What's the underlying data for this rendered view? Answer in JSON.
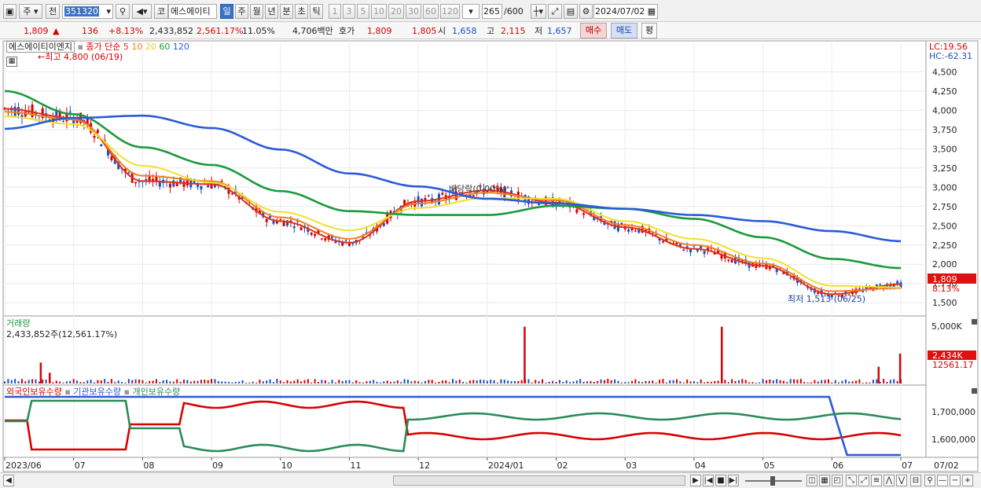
{
  "toolbar": {
    "market_label": "주",
    "view_label": "전",
    "code_value": "351320",
    "name_prefix": "코",
    "stock_name": "에스에이티",
    "period_tabs": [
      "일",
      "주",
      "월",
      "년",
      "분",
      "초",
      "틱"
    ],
    "selected_period": "일",
    "minute_buttons": [
      "1",
      "3",
      "5",
      "10",
      "20",
      "30",
      "60",
      "120"
    ],
    "count_value": "265",
    "count_total": "/600",
    "date_value": "2024/07/02"
  },
  "quote": {
    "price": "1,809",
    "change": "136",
    "change_pct": "+8.13%",
    "volume": "2,433,852",
    "volume_ratio": "2,561.17%",
    "turnover_pct": "11.05%",
    "amount": "4,706백만",
    "quote_label": "호가",
    "ask": "1,809",
    "bid": "1,805",
    "open_label": "시",
    "open": "1,658",
    "high_label": "고",
    "high": "2,115",
    "low_label": "저",
    "low": "1,657",
    "buy_label": "매수",
    "sell_label": "매도",
    "eval_label": "평",
    "up_color": "#d90000",
    "down_color": "#1a4fc4"
  },
  "price_panel": {
    "title": "에스에이티이엔지",
    "ma_label": "종가 단순",
    "ma_periods": [
      "5",
      "10",
      "20",
      "60",
      "120"
    ],
    "ma_colors": [
      "#e03020",
      "#f08020",
      "#f0e030",
      "#1a9a3a",
      "#2a5ad8"
    ],
    "lc_text": "LC:19.56",
    "hc_text": "HC:-62.31",
    "max_annot": "최고 4,800 (06/19)",
    "min_annot": "최저 1,513 (06/25)",
    "dividend_annot": "배당락(0.00%)",
    "current_price_tag": "1,809",
    "current_pct_tag": "8.13%",
    "y_ticks": [
      "4,500",
      "4,250",
      "4,000",
      "3,750",
      "3,500",
      "3,250",
      "3,000",
      "2,750",
      "2,500",
      "2,250",
      "2,000",
      "1,750",
      "1,500"
    ]
  },
  "volume_panel": {
    "title": "거래량",
    "value_text": "2,433,852주(12,561.17%)",
    "y_tick": "5,000K",
    "current_tag": "2,434K",
    "current_pct_tag": "12561.17"
  },
  "holdings_panel": {
    "labels": [
      "외국인보유수량",
      "기관보유수량",
      "개인보유수량"
    ],
    "colors": [
      "#d90000",
      "#2a5ad8",
      "#2a8a5a"
    ],
    "y_ticks": [
      "1,700,000",
      "1,600,000"
    ]
  },
  "x_axis": [
    "2023/06",
    "07",
    "08",
    "09",
    "10",
    "11",
    "12",
    "2024/01",
    "02",
    "03",
    "04",
    "05",
    "06",
    "07"
  ],
  "x_axis_right": "07/02",
  "chart_data": {
    "type": "line",
    "title": "에스에이티이엔지",
    "x": [
      "2023/06",
      "07",
      "08",
      "09",
      "10",
      "11",
      "12",
      "2024/01",
      "02",
      "03",
      "04",
      "05",
      "06",
      "2024/07/02"
    ],
    "ylim": [
      1400,
      4800
    ],
    "series": [
      {
        "name": "5",
        "values": [
          4020,
          3900,
          3080,
          3040,
          2560,
          2280,
          2820,
          2960,
          2800,
          2480,
          2200,
          1980,
          1610,
          1740
        ]
      },
      {
        "name": "10",
        "values": [
          3980,
          3880,
          3150,
          3080,
          2610,
          2330,
          2790,
          2930,
          2830,
          2510,
          2250,
          2010,
          1650,
          1690
        ]
      },
      {
        "name": "20",
        "values": [
          3920,
          3820,
          3280,
          3060,
          2680,
          2440,
          2730,
          2860,
          2850,
          2560,
          2330,
          2080,
          1720,
          1700
        ]
      },
      {
        "name": "60",
        "values": [
          4250,
          3950,
          3520,
          3290,
          2950,
          2690,
          2640,
          2640,
          2760,
          2720,
          2590,
          2350,
          2070,
          1950
        ]
      },
      {
        "name": "120",
        "values": [
          3760,
          3900,
          3930,
          3770,
          3490,
          3180,
          3010,
          2850,
          2790,
          2720,
          2640,
          2560,
          2430,
          2300
        ]
      }
    ]
  }
}
